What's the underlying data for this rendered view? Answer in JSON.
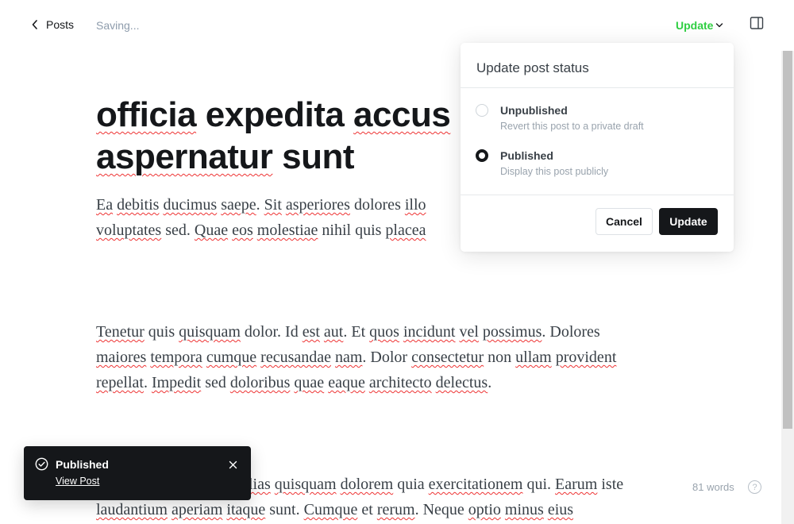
{
  "topbar": {
    "back_label": "Posts",
    "saving_label": "Saving...",
    "update_label": "Update"
  },
  "icons": {
    "back": "chevron-left-icon",
    "update_dropdown": "chevron-down-icon",
    "sidebar": "sidebar-panel-icon",
    "toast_status": "check-circle-icon",
    "toast_close": "close-icon",
    "help": "question-circle-icon"
  },
  "post": {
    "title_line1_spellchecked": "officia",
    "title_line1_rest": " expedita ",
    "title_line1_tail": "accus",
    "title_line2_spellchecked": "aspernatur",
    "title_line2_rest": " sunt"
  },
  "paragraph1": {
    "w1": "Ea",
    "w2": "debitis",
    "w3": "ducimus",
    "w4": "saepe",
    "dot1": ". ",
    "w5": "Sit",
    "w6": "asperiores",
    "w7": " dolores ",
    "w8": "illo",
    "w9": "voluptates",
    "w10": " sed. ",
    "w11": "Quae",
    "w12": "eos",
    "w13": "molestiae",
    "w14": " nihil quis ",
    "w15": "placea"
  },
  "paragraph2": {
    "w1": "Tenetur",
    "w2": " quis ",
    "w3": "quisquam",
    "w4": " dolor. Id ",
    "w5": "est",
    "w6": "aut",
    "w7": ". Et ",
    "w8": "quos",
    "w9": "incidunt",
    "w10": "vel",
    "w11": "possimus",
    "w12": ". Dolores",
    "w13": "maiores",
    "w14": "tempora",
    "w15": "cumque",
    "w16": "recusandae",
    "w17": "nam",
    "w18": ". Dolor ",
    "w19": "consectetur",
    "w20": " non ",
    "w21": "ullam",
    "w22": "provident",
    "w23": "repellat",
    "w24": ". ",
    "w25": "Impedit",
    "w26": " sed ",
    "w27": "doloribus",
    "w28": "quae",
    "w29": "eaque",
    "w30": "architecto",
    "w31": "delectus",
    "w32": "."
  },
  "paragraph3": {
    "w1": "lias",
    "w2": "quisquam",
    "w3": "dolorem",
    "w4": " quia ",
    "w5": "exercitationem",
    "w6": " qui. ",
    "w7": "Earum",
    "w8": " iste",
    "w9": "laudantium",
    "w10": "aperiam",
    "w11": "itaque",
    "w12": " sunt. ",
    "w13": "Cumque",
    "w14": " et ",
    "w15": "rerum",
    "w16": ". Neque ",
    "w17": "optio",
    "w18": "minus",
    "w19": "eius"
  },
  "popover": {
    "title": "Update post status",
    "options": [
      {
        "label": "Unpublished",
        "description": "Revert this post to a private draft",
        "selected": false
      },
      {
        "label": "Published",
        "description": "Display this post publicly",
        "selected": true
      }
    ],
    "cancel_label": "Cancel",
    "update_label": "Update"
  },
  "toast": {
    "title": "Published",
    "link_label": "View Post"
  },
  "footer": {
    "word_count": "81 words",
    "help_glyph": "?"
  },
  "colors": {
    "accent_green": "#30cf43",
    "dark": "#15171a",
    "muted": "#8e9cac",
    "spellcheck": "#e33"
  }
}
